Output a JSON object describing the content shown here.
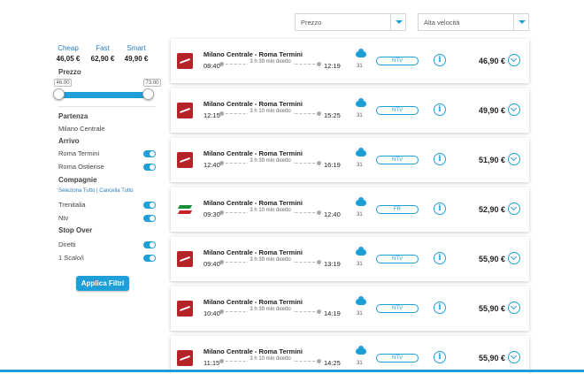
{
  "sort_select": {
    "value": "Prezzo"
  },
  "type_select": {
    "value": "Alta velocità"
  },
  "categories": [
    {
      "label": "Cheap",
      "price": "46,05 €"
    },
    {
      "label": "Fast",
      "price": "62,90 €"
    },
    {
      "label": "Smart",
      "price": "49,90 €"
    }
  ],
  "filters": {
    "prezzo_label": "Prezzo",
    "price_min": "46.00",
    "price_max": "73.00",
    "partenza_label": "Partenza",
    "partenza_value": "Milano Centrale",
    "arrivo_label": "Arrivo",
    "arrivo_options": [
      "Roma Termini",
      "Roma Ostiense"
    ],
    "compagnie_label": "Compagnie",
    "select_all": "Seleziona Tutto",
    "cancel_all": "Cancella Tutto",
    "compagnie_options": [
      "Trenitalia",
      "Ntv"
    ],
    "stopover_label": "Stop Over",
    "stopover_options": [
      "Diretti",
      "1 Scalo/i"
    ],
    "apply_label": "Applica Filtri"
  },
  "results": [
    {
      "logo": "ntv-logo-icon",
      "route": "Milano Centrale - Roma Termini",
      "dep": "08:40",
      "arr": "12:19",
      "duration": "3 h 39 min diretto",
      "temp": "31",
      "operator": "NTV",
      "price": "46,90 €"
    },
    {
      "logo": "ntv-logo-icon",
      "route": "Milano Centrale - Roma Termini",
      "dep": "12:15",
      "arr": "15:25",
      "duration": "3 h 10 min diretto",
      "temp": "31",
      "operator": "NTV",
      "price": "49,90 €"
    },
    {
      "logo": "ntv-logo-icon",
      "route": "Milano Centrale - Roma Termini",
      "dep": "12:40",
      "arr": "16:19",
      "duration": "3 h 39 min diretto",
      "temp": "31",
      "operator": "NTV",
      "price": "51,90 €"
    },
    {
      "logo": "frecciarossa-logo-icon",
      "route": "Milano Centrale - Roma Termini",
      "dep": "09:30",
      "arr": "12:40",
      "duration": "3 h 10 min diretto",
      "temp": "31",
      "operator": "FR",
      "price": "52,90 €"
    },
    {
      "logo": "ntv-logo-icon",
      "route": "Milano Centrale - Roma Termini",
      "dep": "09:40",
      "arr": "13:19",
      "duration": "3 h 39 min diretto",
      "temp": "31",
      "operator": "NTV",
      "price": "55,90 €"
    },
    {
      "logo": "ntv-logo-icon",
      "route": "Milano Centrale - Roma Termini",
      "dep": "10:40",
      "arr": "14:19",
      "duration": "3 h 39 min diretto",
      "temp": "31",
      "operator": "NTV",
      "price": "55,90 €"
    },
    {
      "logo": "ntv-logo-icon",
      "route": "Milano Centrale - Roma Termini",
      "dep": "11:15",
      "arr": "14:25",
      "duration": "3 h 10 min diretto",
      "temp": "31",
      "operator": "NTV",
      "price": "55,90 €"
    }
  ],
  "colors": {
    "accent": "#1f9fd7",
    "ntv": "#b52328"
  }
}
